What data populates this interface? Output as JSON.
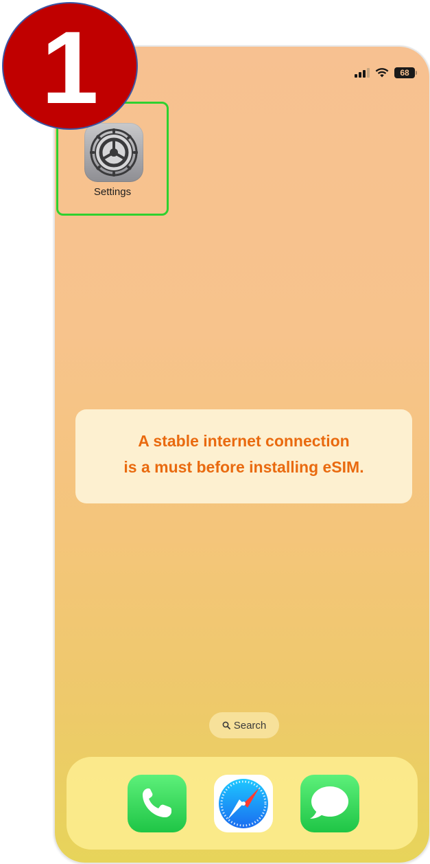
{
  "step": {
    "number": "1"
  },
  "status_bar": {
    "battery_level": "68"
  },
  "home_screen": {
    "apps": [
      {
        "label": "Settings",
        "icon": "settings-gear-icon"
      }
    ],
    "notice": {
      "line1": "A stable internet connection",
      "line2": "is a must before installing eSIM."
    },
    "search": {
      "label": "Search",
      "icon": "magnifier-icon"
    },
    "dock": [
      {
        "name": "Phone",
        "icon": "phone-handset-icon"
      },
      {
        "name": "Safari",
        "icon": "safari-compass-icon"
      },
      {
        "name": "Messages",
        "icon": "message-bubble-icon"
      }
    ]
  },
  "colors": {
    "highlight": "#2fd12f",
    "step_badge": "#c00000",
    "notice_text": "#e96a0f"
  }
}
